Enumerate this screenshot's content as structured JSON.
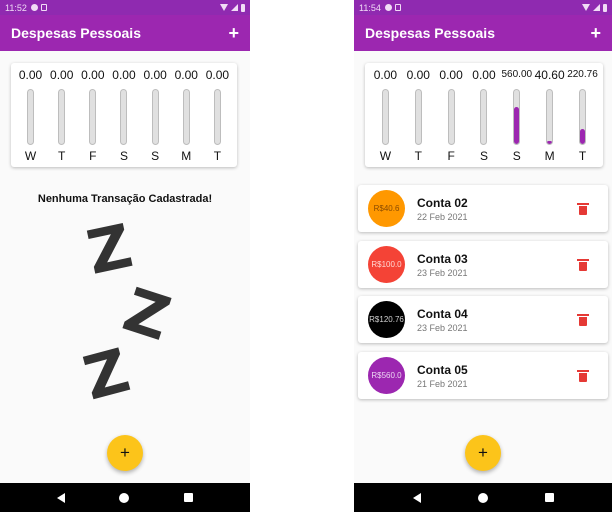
{
  "screens": [
    {
      "status_time": "11:52",
      "app_title": "Despesas Pessoais",
      "add_label": "+",
      "chart_data": {
        "type": "bar",
        "categories": [
          "W",
          "T",
          "F",
          "S",
          "S",
          "M",
          "T"
        ],
        "value_labels": [
          "0.00",
          "0.00",
          "0.00",
          "0.00",
          "0.00",
          "0.00",
          "0.00"
        ],
        "fractions": [
          0,
          0,
          0,
          0,
          0,
          0,
          0
        ]
      },
      "empty_message": "Nenhuma Transação Cadastrada!",
      "zzz": [
        "Z",
        "Z",
        "Z"
      ],
      "fab_label": "+"
    },
    {
      "status_time": "11:54",
      "app_title": "Despesas Pessoais",
      "add_label": "+",
      "chart_data": {
        "type": "bar",
        "categories": [
          "W",
          "T",
          "F",
          "S",
          "S",
          "M",
          "T"
        ],
        "value_labels": [
          "0.00",
          "0.00",
          "0.00",
          "0.00",
          "560.00",
          "40.60",
          "220.76"
        ],
        "fractions": [
          0,
          0,
          0,
          0,
          0.68,
          0.05,
          0.27
        ]
      },
      "transactions": [
        {
          "value": "R$40.6",
          "title": "Conta 02",
          "date": "22 Feb 2021",
          "color": "#ff9800",
          "text_color": "#8a4b00"
        },
        {
          "value": "R$100.0",
          "title": "Conta 03",
          "date": "23 Feb 2021",
          "color": "#f44336",
          "text_color": "#ffd6d2"
        },
        {
          "value": "R$120.76",
          "title": "Conta 04",
          "date": "23 Feb 2021",
          "color": "#000000",
          "text_color": "#d0d0d0"
        },
        {
          "value": "R$560.0",
          "title": "Conta 05",
          "date": "21 Feb 2021",
          "color": "#9c27b0",
          "text_color": "#ecd3f2"
        }
      ],
      "fab_label": "+"
    }
  ]
}
